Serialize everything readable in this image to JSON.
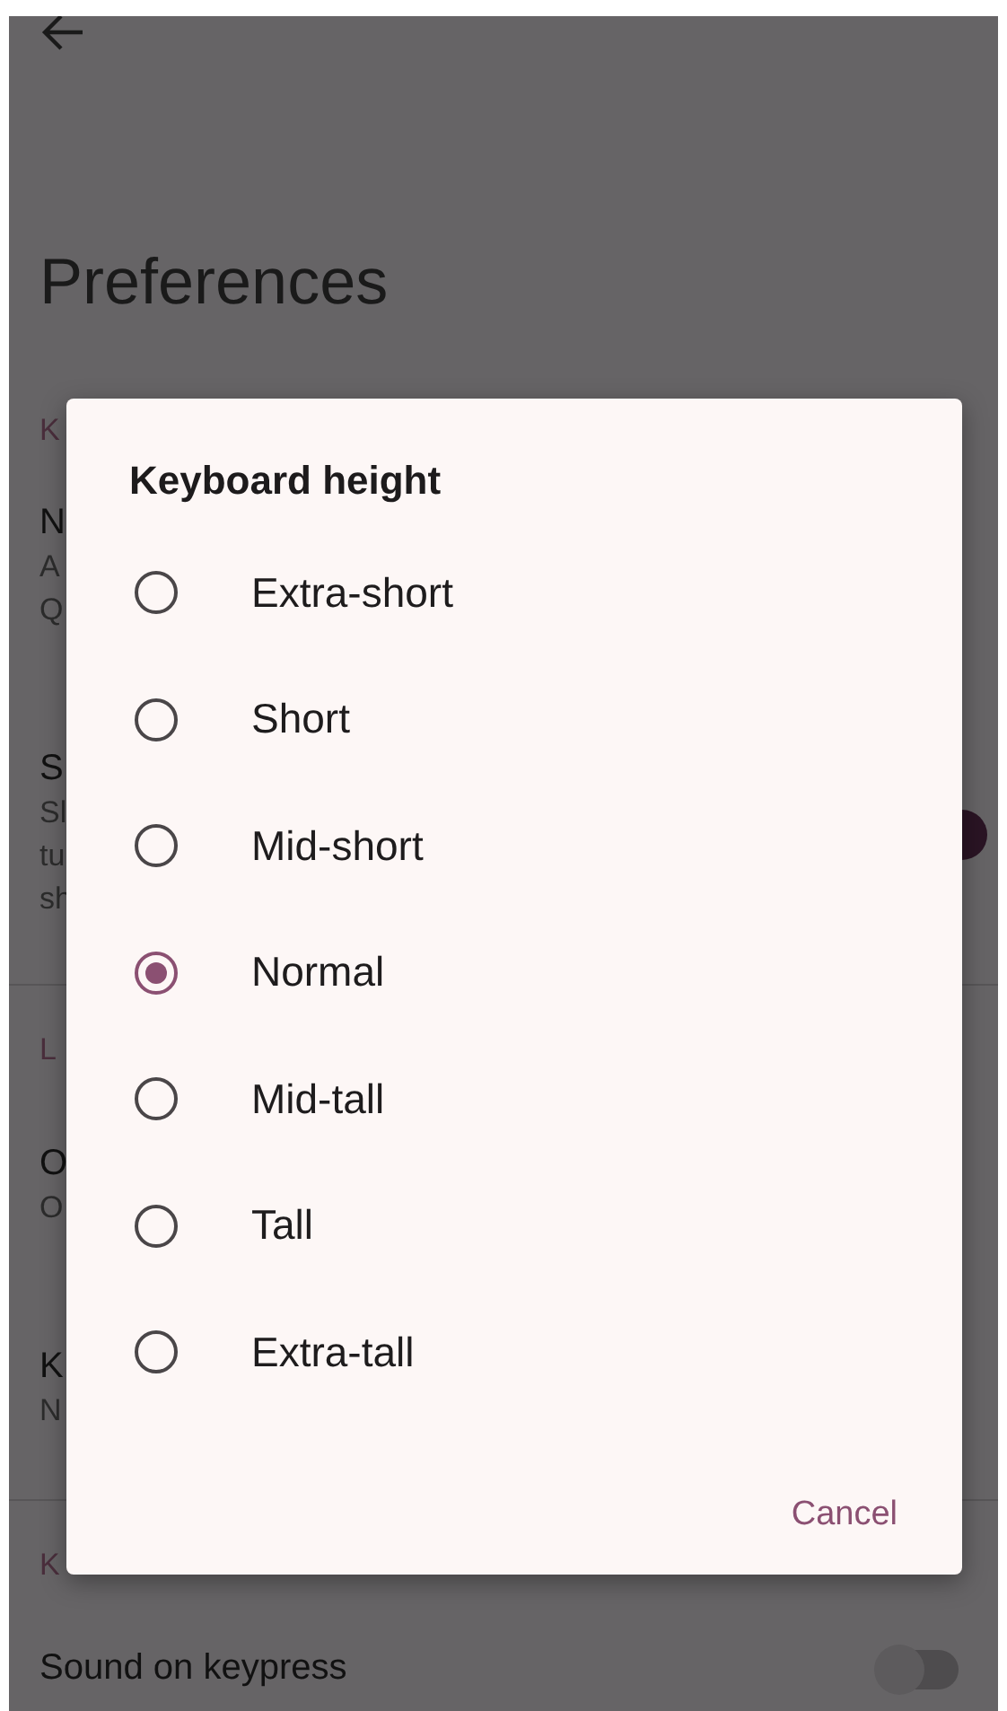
{
  "top_bar": {
    "title": "Preferences"
  },
  "background_items": [
    {
      "kind": "section",
      "text": "K"
    },
    {
      "kind": "setting",
      "title": "N",
      "lines": [
        "A",
        "Q"
      ]
    },
    {
      "kind": "setting",
      "title": "S",
      "lines": [
        "Sl",
        "tu",
        "sh"
      ],
      "switch_on": true
    },
    {
      "kind": "divider"
    },
    {
      "kind": "section",
      "text": "L"
    },
    {
      "kind": "setting",
      "title": "O",
      "lines": [
        "O"
      ]
    },
    {
      "kind": "setting",
      "title": "K",
      "lines": [
        "N"
      ]
    },
    {
      "kind": "divider"
    },
    {
      "kind": "section",
      "text": "K"
    },
    {
      "kind": "setting",
      "title": "Sound on keypress",
      "switch_on": false
    }
  ],
  "dialog": {
    "title": "Keyboard height",
    "options": [
      {
        "label": "Extra-short",
        "selected": false
      },
      {
        "label": "Short",
        "selected": false
      },
      {
        "label": "Mid-short",
        "selected": false
      },
      {
        "label": "Normal",
        "selected": true
      },
      {
        "label": "Mid-tall",
        "selected": false
      },
      {
        "label": "Tall",
        "selected": false
      },
      {
        "label": "Extra-tall",
        "selected": false
      }
    ],
    "buttons": [
      "Cancel"
    ]
  }
}
